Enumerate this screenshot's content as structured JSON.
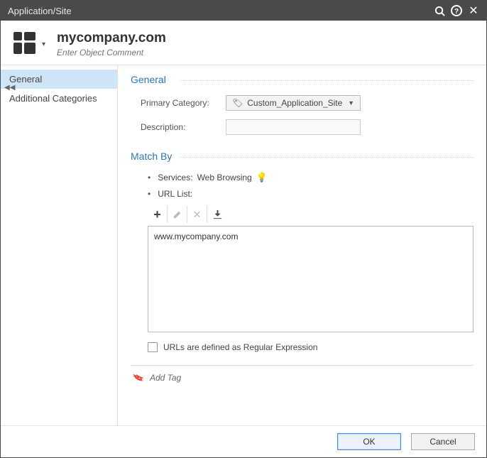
{
  "window": {
    "title": "Application/Site"
  },
  "header": {
    "object_name": "mycompany.com",
    "comment_placeholder": "Enter Object Comment"
  },
  "sidebar": {
    "items": [
      {
        "label": "General",
        "active": true
      },
      {
        "label": "Additional Categories",
        "active": false
      }
    ]
  },
  "general": {
    "section_title": "General",
    "primary_category_label": "Primary Category:",
    "primary_category_value": "Custom_Application_Site",
    "description_label": "Description:",
    "description_value": ""
  },
  "matchby": {
    "section_title": "Match By",
    "services_label": "Services:",
    "services_value": "Web Browsing",
    "url_list_label": "URL List:",
    "url_items": [
      "www.mycompany.com"
    ],
    "regex_label": "URLs are defined as Regular Expression"
  },
  "tags": {
    "add_label": "Add Tag"
  },
  "footer": {
    "ok": "OK",
    "cancel": "Cancel"
  }
}
